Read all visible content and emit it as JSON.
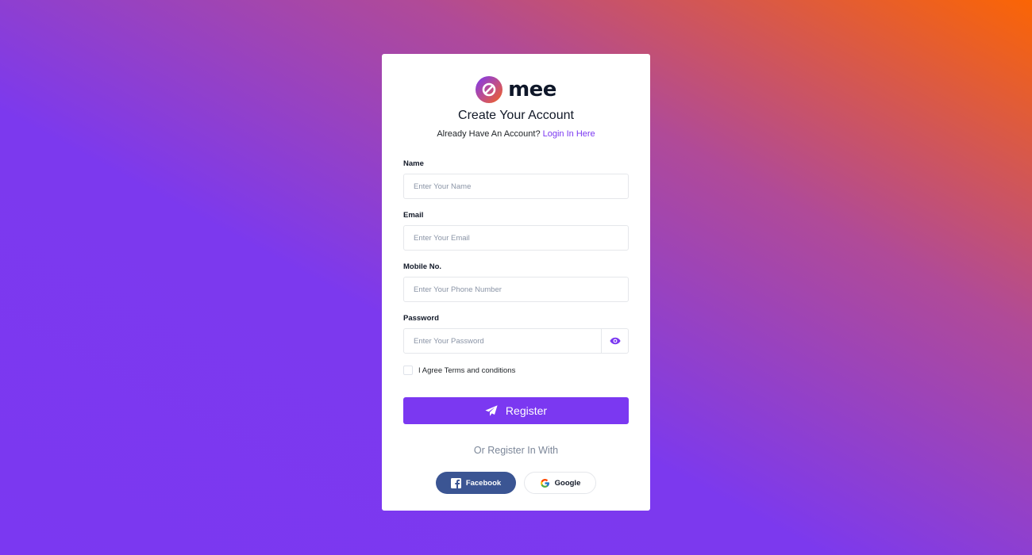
{
  "brand": {
    "name": "mee"
  },
  "form": {
    "title": "Create Your Account",
    "subtitle_prefix": "Already Have An Account?",
    "login_link": "Login In Here",
    "fields": {
      "name": {
        "label": "Name",
        "placeholder": "Enter Your Name"
      },
      "email": {
        "label": "Email",
        "placeholder": "Enter Your Email"
      },
      "mobile": {
        "label": "Mobile No.",
        "placeholder": "Enter Your Phone Number"
      },
      "password": {
        "label": "Password",
        "placeholder": "Enter Your Password"
      }
    },
    "agree_label": "I Agree Terms and conditions",
    "register_label": "Register",
    "alt_register_text": "Or Register In With",
    "social": {
      "facebook_label": "Facebook",
      "google_label": "Google"
    }
  },
  "icons": {
    "logo": "logo-mark-icon",
    "eye": "eye-icon",
    "send": "paper-plane-icon",
    "facebook": "facebook-icon",
    "google": "google-icon"
  },
  "colors": {
    "accent": "#7b38f1",
    "facebook": "#3b5593",
    "gradient_start": "#7b38f1",
    "gradient_end": "#fb6504"
  }
}
